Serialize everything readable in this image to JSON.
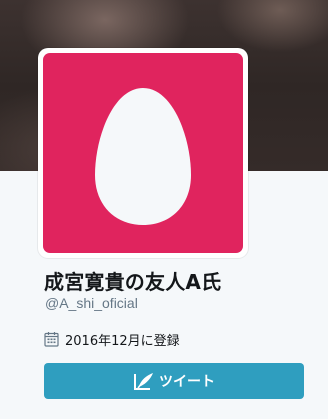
{
  "profile": {
    "display_name": "成宮寛貴の友人A氏",
    "screen_name": "@A_shi_oficial",
    "joined": "2016年12月に登録",
    "avatar_color": "#e0245e",
    "avatar_icon": "egg-icon",
    "calendar_icon": "calendar-icon"
  },
  "actions": {
    "tweet_label": "ツイート",
    "tweet_icon": "quill-icon",
    "tweet_color": "#2f9ebf"
  }
}
